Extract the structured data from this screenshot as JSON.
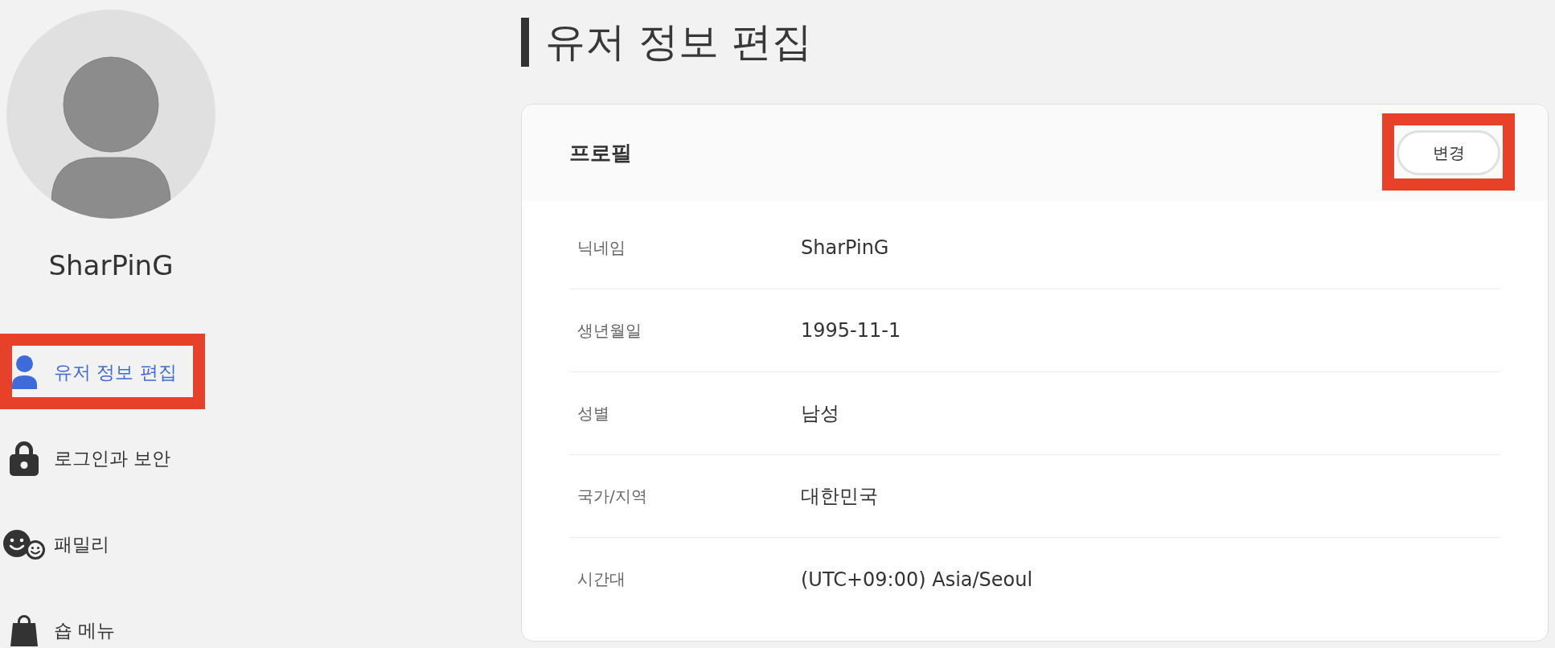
{
  "sidebar": {
    "username": "SharPinG",
    "items": [
      {
        "label": "유저 정보 편집",
        "selected": true,
        "highlighted": true
      },
      {
        "label": "로그인과 보안",
        "selected": false,
        "highlighted": false
      },
      {
        "label": "패밀리",
        "selected": false,
        "highlighted": false
      },
      {
        "label": "숍 메뉴",
        "selected": false,
        "highlighted": false
      }
    ]
  },
  "page": {
    "title": "유저 정보 편집"
  },
  "profile_card": {
    "title": "프로필",
    "button": {
      "label": "변경",
      "highlighted": true
    },
    "fields": [
      {
        "label": "닉네임",
        "value": "SharPinG"
      },
      {
        "label": "생년월일",
        "value": "1995-11-1"
      },
      {
        "label": "성별",
        "value": "남성"
      },
      {
        "label": "국가/지역",
        "value": "대한민국"
      },
      {
        "label": "시간대",
        "value": "(UTC+09:00) Asia/Seoul"
      }
    ]
  }
}
